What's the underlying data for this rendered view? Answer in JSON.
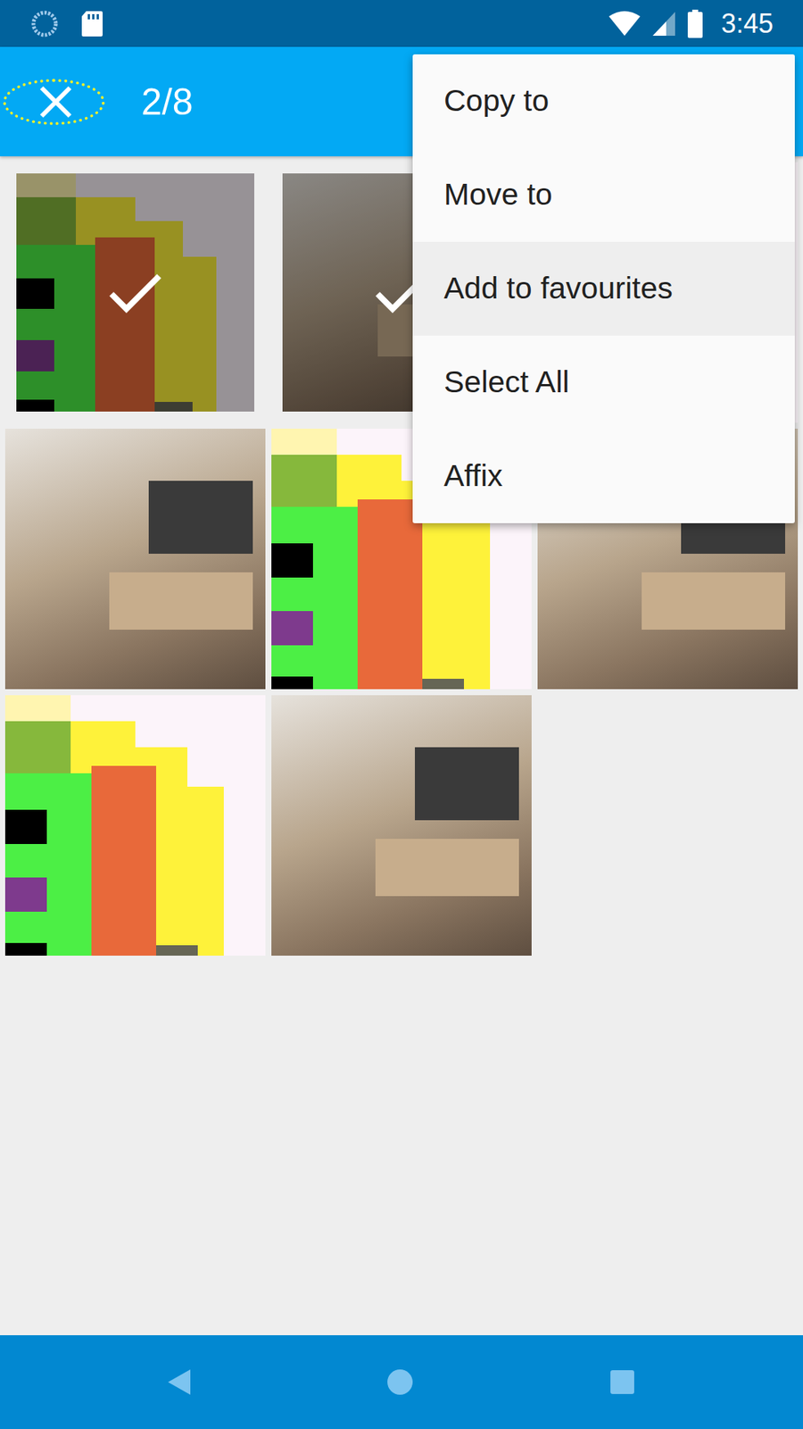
{
  "status_bar": {
    "time": "3:45"
  },
  "app_bar": {
    "close_button": {
      "focused": true
    },
    "count": "2/8"
  },
  "menu": {
    "items": [
      {
        "label": "Copy to",
        "pressed": false
      },
      {
        "label": "Move to",
        "pressed": false
      },
      {
        "label": "Add to favourites",
        "pressed": true
      },
      {
        "label": "Select All",
        "pressed": false
      },
      {
        "label": "Affix",
        "pressed": false
      }
    ]
  },
  "thumbnails": [
    {
      "kind": "pattern",
      "selected": true
    },
    {
      "kind": "room",
      "selected": true
    },
    {
      "kind": "pattern",
      "selected": false
    },
    {
      "kind": "room",
      "selected": false
    },
    {
      "kind": "pattern",
      "selected": false
    },
    {
      "kind": "room",
      "selected": false
    },
    {
      "kind": "pattern",
      "selected": false
    },
    {
      "kind": "room",
      "selected": false
    }
  ]
}
